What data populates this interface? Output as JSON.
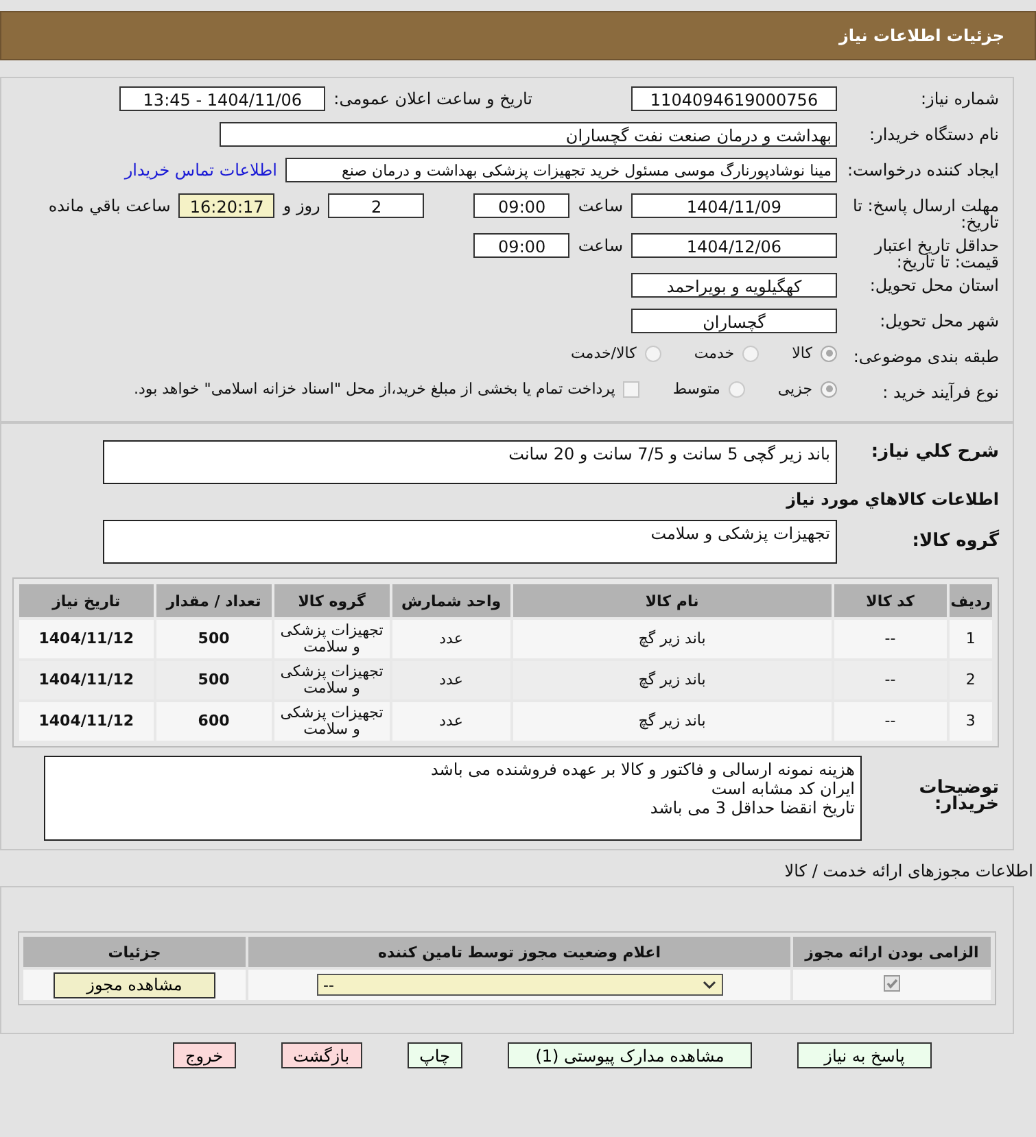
{
  "header": {
    "title": "جزئیات اطلاعات نیاز"
  },
  "need_number": {
    "label": "شماره نیاز:",
    "value": "1104094619000756"
  },
  "announce": {
    "label": "تاریخ و ساعت اعلان عمومی:",
    "value": "1404/11/06 - 13:45"
  },
  "buyer_org": {
    "label": "نام دستگاه خریدار:",
    "value": "بهداشت و درمان صنعت نفت گچساران"
  },
  "creator": {
    "label": "ایجاد کننده درخواست:",
    "value": "مینا نوشادپورنارگ موسی مسئول خرید تجهیزات پزشکی  بهداشت و درمان صنع",
    "link": "اطلاعات تماس خریدار"
  },
  "deadline": {
    "label": "مهلت ارسال پاسخ: تا تاریخ:",
    "date": "1404/11/09",
    "time_label": "ساعت",
    "time": "09:00",
    "days": "2",
    "days_label": "روز و",
    "remaining": "16:20:17",
    "remaining_label": "ساعت باقي مانده"
  },
  "validity": {
    "label": "حداقل تاریخ اعتبار قیمت: تا تاریخ:",
    "date": "1404/12/06",
    "time_label": "ساعت",
    "time": "09:00"
  },
  "province": {
    "label": "استان محل تحویل:",
    "value": "کهگیلویه و بویراحمد"
  },
  "city": {
    "label": "شهر محل تحویل:",
    "value": "گچساران"
  },
  "category": {
    "label": "طبقه بندی موضوعی:",
    "options": [
      {
        "label": "کالا",
        "selected": true
      },
      {
        "label": "خدمت",
        "selected": false
      },
      {
        "label": "کالا/خدمت",
        "selected": false
      }
    ]
  },
  "process": {
    "label": "نوع فرآیند خرید :",
    "options": [
      {
        "label": "جزیی",
        "selected": true
      },
      {
        "label": "متوسط",
        "selected": false
      }
    ],
    "treasury": {
      "label": "پرداخت تمام یا بخشی از مبلغ خرید،از محل \"اسناد خزانه اسلامی\" خواهد بود.",
      "checked": false
    }
  },
  "description": {
    "label": "شرح کلي نياز:",
    "value": "باند زیر گچی 5 سانت و 7/5 سانت و 20 سانت"
  },
  "goods_heading": "اطلاعات کالاهاي مورد نياز",
  "goods_group": {
    "label": "گروه کالا:",
    "value": "تجهیزات پزشکی و سلامت"
  },
  "table": {
    "columns": [
      "ردیف",
      "کد کالا",
      "نام کالا",
      "واحد شمارش",
      "گروه کالا",
      "تعداد / مقدار",
      "تاریخ نیاز"
    ],
    "rows": [
      [
        "1",
        "--",
        "باند زیر گچ",
        "عدد",
        "تجهیزات پزشکی و سلامت",
        "500",
        "1404/11/12"
      ],
      [
        "2",
        "--",
        "باند زیر گچ",
        "عدد",
        "تجهیزات پزشکی و سلامت",
        "500",
        "1404/11/12"
      ],
      [
        "3",
        "--",
        "باند زیر گچ",
        "عدد",
        "تجهیزات پزشکی و سلامت",
        "600",
        "1404/11/12"
      ]
    ]
  },
  "buyer_notes": {
    "label": "توضیحات خریدار:",
    "lines": [
      "هزینه نمونه ارسالی و فاکتور و کالا بر عهده فروشنده می باشد",
      "ایران کد مشابه است",
      "تاریخ انقضا حداقل 3 می باشد"
    ]
  },
  "permits": {
    "title": "اطلاعات مجوزهای ارائه خدمت / کالا",
    "columns": [
      "الزامی بودن ارائه مجوز",
      "اعلام وضعیت مجوز توسط تامین کننده",
      "جزئیات"
    ],
    "rows": [
      {
        "required": true,
        "status": "--",
        "details_button": "مشاهده مجوز"
      }
    ]
  },
  "buttons": [
    {
      "label": "پاسخ به نیاز",
      "kind": "normal"
    },
    {
      "label": "مشاهده مدارک پیوستی (1)",
      "kind": "normal"
    },
    {
      "label": "چاپ",
      "kind": "normal"
    },
    {
      "label": "بازگشت",
      "kind": "danger"
    },
    {
      "label": "خروج",
      "kind": "danger"
    }
  ]
}
